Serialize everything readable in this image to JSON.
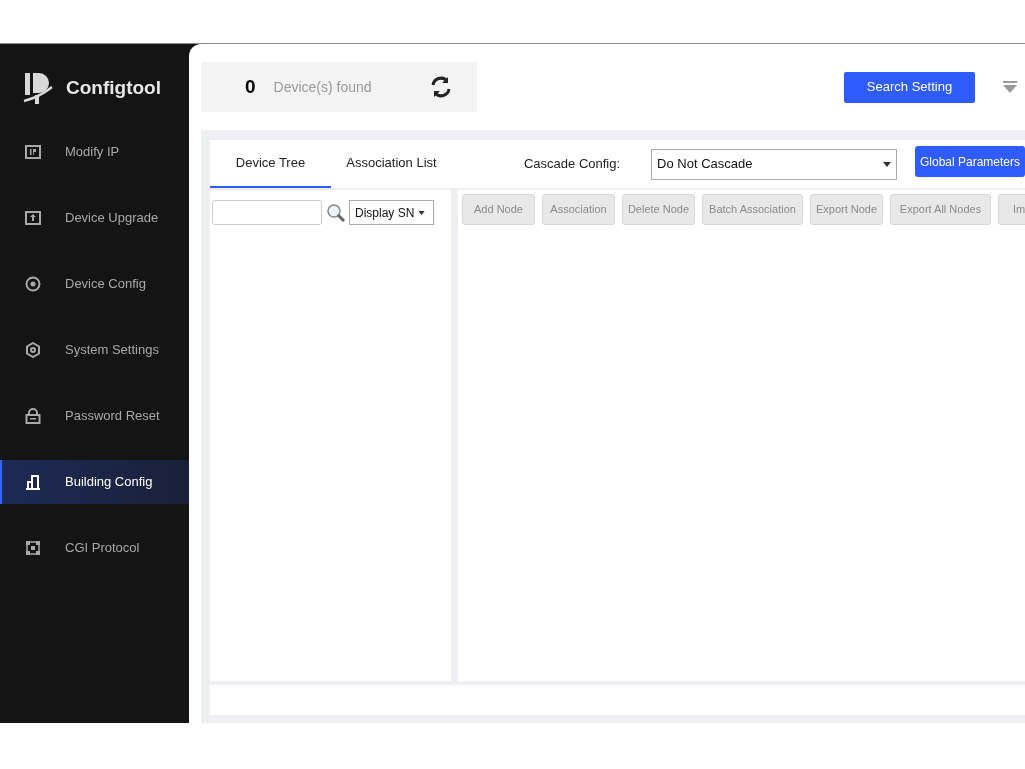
{
  "app": {
    "name": "Configtool"
  },
  "sidebar": {
    "items": [
      {
        "label": "Modify IP",
        "kind": "ip",
        "selected": false
      },
      {
        "label": "Device Upgrade",
        "kind": "upgrade",
        "selected": false
      },
      {
        "label": "Device Config",
        "kind": "config",
        "selected": false
      },
      {
        "label": "System Settings",
        "kind": "settings",
        "selected": false
      },
      {
        "label": "Password Reset",
        "kind": "password",
        "selected": false
      },
      {
        "label": "Building Config",
        "kind": "building",
        "selected": true
      },
      {
        "label": "CGI Protocol",
        "kind": "protocol",
        "selected": false
      }
    ]
  },
  "header": {
    "count": "0",
    "count_label": "Device(s) found",
    "search_button": "Search Setting"
  },
  "tabs": [
    {
      "label": "Device Tree",
      "selected": true
    },
    {
      "label": "Association List",
      "selected": false
    }
  ],
  "cascade": {
    "label": "Cascade Config:",
    "value": "Do Not Cascade"
  },
  "global_button": "Global Parameters",
  "tree": {
    "display": "Display SN"
  },
  "toolbar": [
    "Add Node",
    "Association",
    "Delete Node",
    "Batch Association",
    "Export Node",
    "Export All Nodes",
    "Im"
  ]
}
